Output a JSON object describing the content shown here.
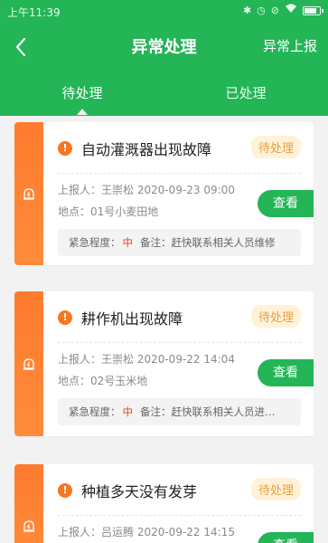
{
  "statusbar": {
    "time": "上午11:39",
    "icons": [
      "bluetooth-icon",
      "alarm-icon",
      "mute-icon",
      "wifi-icon",
      "battery-icon"
    ]
  },
  "navbar": {
    "title": "异常处理",
    "action_label": "异常上报",
    "back_icon": "back-arrow-icon"
  },
  "tabs": [
    {
      "label": "待处理",
      "active": true
    },
    {
      "label": "已处理",
      "active": false
    }
  ],
  "colors": {
    "primary": "#23b556",
    "accent_orange": "#ff7b2e",
    "badge_bg": "#fff2d9",
    "badge_text": "#e9a03b",
    "urgency": "#e8402e"
  },
  "cards": [
    {
      "title": "自动灌溉器出现故障",
      "status": "待处理",
      "reporter": "上报人：王崇松 2020-09-23 09:00",
      "location": "地点：01号小麦田地",
      "urgency_label": "紧急程度：",
      "urgency_value": "中",
      "remark": "备注：赶快联系相关人员维修",
      "view_label": "查看"
    },
    {
      "title": "耕作机出现故障",
      "status": "待处理",
      "reporter": "上报人：王崇松 2020-09-22 14:04",
      "location": "地点：02号玉米地",
      "urgency_label": "紧急程度：",
      "urgency_value": "中",
      "remark": "备注：赶快联系相关人员进…",
      "view_label": "查看"
    },
    {
      "title": "种植多天没有发芽",
      "status": "待处理",
      "reporter": "上报人：吕运腾 2020-09-22 14:15",
      "location": "",
      "urgency_label": "",
      "urgency_value": "",
      "remark": "",
      "view_label": "查看"
    }
  ]
}
